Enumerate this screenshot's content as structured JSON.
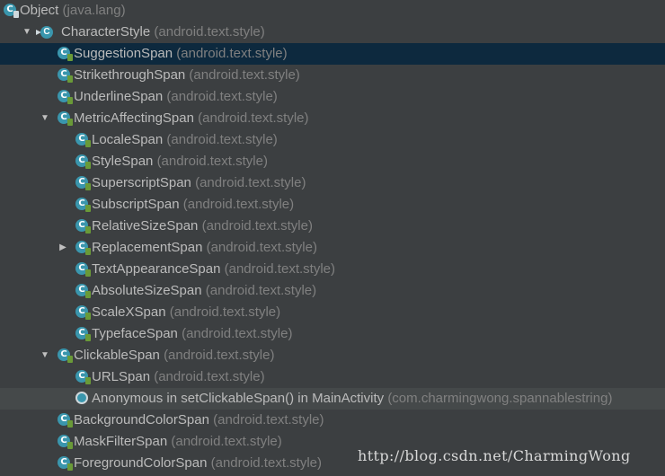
{
  "tree": {
    "rows": [
      {
        "name": "Object",
        "pkg": "(java.lang)",
        "indent": 0,
        "arrow": "",
        "icon": "class-icon",
        "state": ""
      },
      {
        "name": "CharacterStyle",
        "pkg": "(android.text.style)",
        "indent": 1,
        "arrow": "expanded",
        "icon": "abstract-class-icon",
        "state": ""
      },
      {
        "name": "SuggestionSpan",
        "pkg": "(android.text.style)",
        "indent": 2,
        "arrow": "",
        "icon": "class-icon",
        "state": "selected"
      },
      {
        "name": "StrikethroughSpan",
        "pkg": "(android.text.style)",
        "indent": 2,
        "arrow": "",
        "icon": "class-icon",
        "state": ""
      },
      {
        "name": "UnderlineSpan",
        "pkg": "(android.text.style)",
        "indent": 2,
        "arrow": "",
        "icon": "class-icon",
        "state": ""
      },
      {
        "name": "MetricAffectingSpan",
        "pkg": "(android.text.style)",
        "indent": 2,
        "arrow": "expanded",
        "icon": "class-icon",
        "state": ""
      },
      {
        "name": "LocaleSpan",
        "pkg": "(android.text.style)",
        "indent": 3,
        "arrow": "",
        "icon": "class-icon",
        "state": ""
      },
      {
        "name": "StyleSpan",
        "pkg": "(android.text.style)",
        "indent": 3,
        "arrow": "",
        "icon": "class-icon",
        "state": ""
      },
      {
        "name": "SuperscriptSpan",
        "pkg": "(android.text.style)",
        "indent": 3,
        "arrow": "",
        "icon": "class-icon",
        "state": ""
      },
      {
        "name": "SubscriptSpan",
        "pkg": "(android.text.style)",
        "indent": 3,
        "arrow": "",
        "icon": "class-icon",
        "state": ""
      },
      {
        "name": "RelativeSizeSpan",
        "pkg": "(android.text.style)",
        "indent": 3,
        "arrow": "",
        "icon": "class-icon",
        "state": ""
      },
      {
        "name": "ReplacementSpan",
        "pkg": "(android.text.style)",
        "indent": 3,
        "arrow": "collapsed",
        "icon": "class-icon",
        "state": ""
      },
      {
        "name": "TextAppearanceSpan",
        "pkg": "(android.text.style)",
        "indent": 3,
        "arrow": "",
        "icon": "class-icon",
        "state": ""
      },
      {
        "name": "AbsoluteSizeSpan",
        "pkg": "(android.text.style)",
        "indent": 3,
        "arrow": "",
        "icon": "class-icon",
        "state": ""
      },
      {
        "name": "ScaleXSpan",
        "pkg": "(android.text.style)",
        "indent": 3,
        "arrow": "",
        "icon": "class-icon",
        "state": ""
      },
      {
        "name": "TypefaceSpan",
        "pkg": "(android.text.style)",
        "indent": 3,
        "arrow": "",
        "icon": "class-icon",
        "state": ""
      },
      {
        "name": "ClickableSpan",
        "pkg": "(android.text.style)",
        "indent": 2,
        "arrow": "expanded",
        "icon": "class-icon",
        "state": ""
      },
      {
        "name": "URLSpan",
        "pkg": "(android.text.style)",
        "indent": 3,
        "arrow": "",
        "icon": "class-icon",
        "state": ""
      },
      {
        "name": "Anonymous in setClickableSpan() in MainActivity",
        "pkg": "(com.charmingwong.spannablestring)",
        "indent": 3,
        "arrow": "",
        "icon": "anonymous-class-icon",
        "state": "hover"
      },
      {
        "name": "BackgroundColorSpan",
        "pkg": "(android.text.style)",
        "indent": 2,
        "arrow": "",
        "icon": "class-icon",
        "state": ""
      },
      {
        "name": "MaskFilterSpan",
        "pkg": "(android.text.style)",
        "indent": 2,
        "arrow": "",
        "icon": "class-icon",
        "state": ""
      },
      {
        "name": "ForegroundColorSpan",
        "pkg": "(android.text.style)",
        "indent": 2,
        "arrow": "",
        "icon": "class-icon",
        "state": ""
      }
    ]
  },
  "watermark": "http://blog.csdn.net/CharmingWong",
  "colors": {
    "background": "#3c3f41",
    "selected": "#0d293e",
    "hover": "#45494a",
    "class_icon": "#3a96ad",
    "access_lock": "#6a9a38",
    "text": "#bbbbbb",
    "package_text": "#808080"
  }
}
